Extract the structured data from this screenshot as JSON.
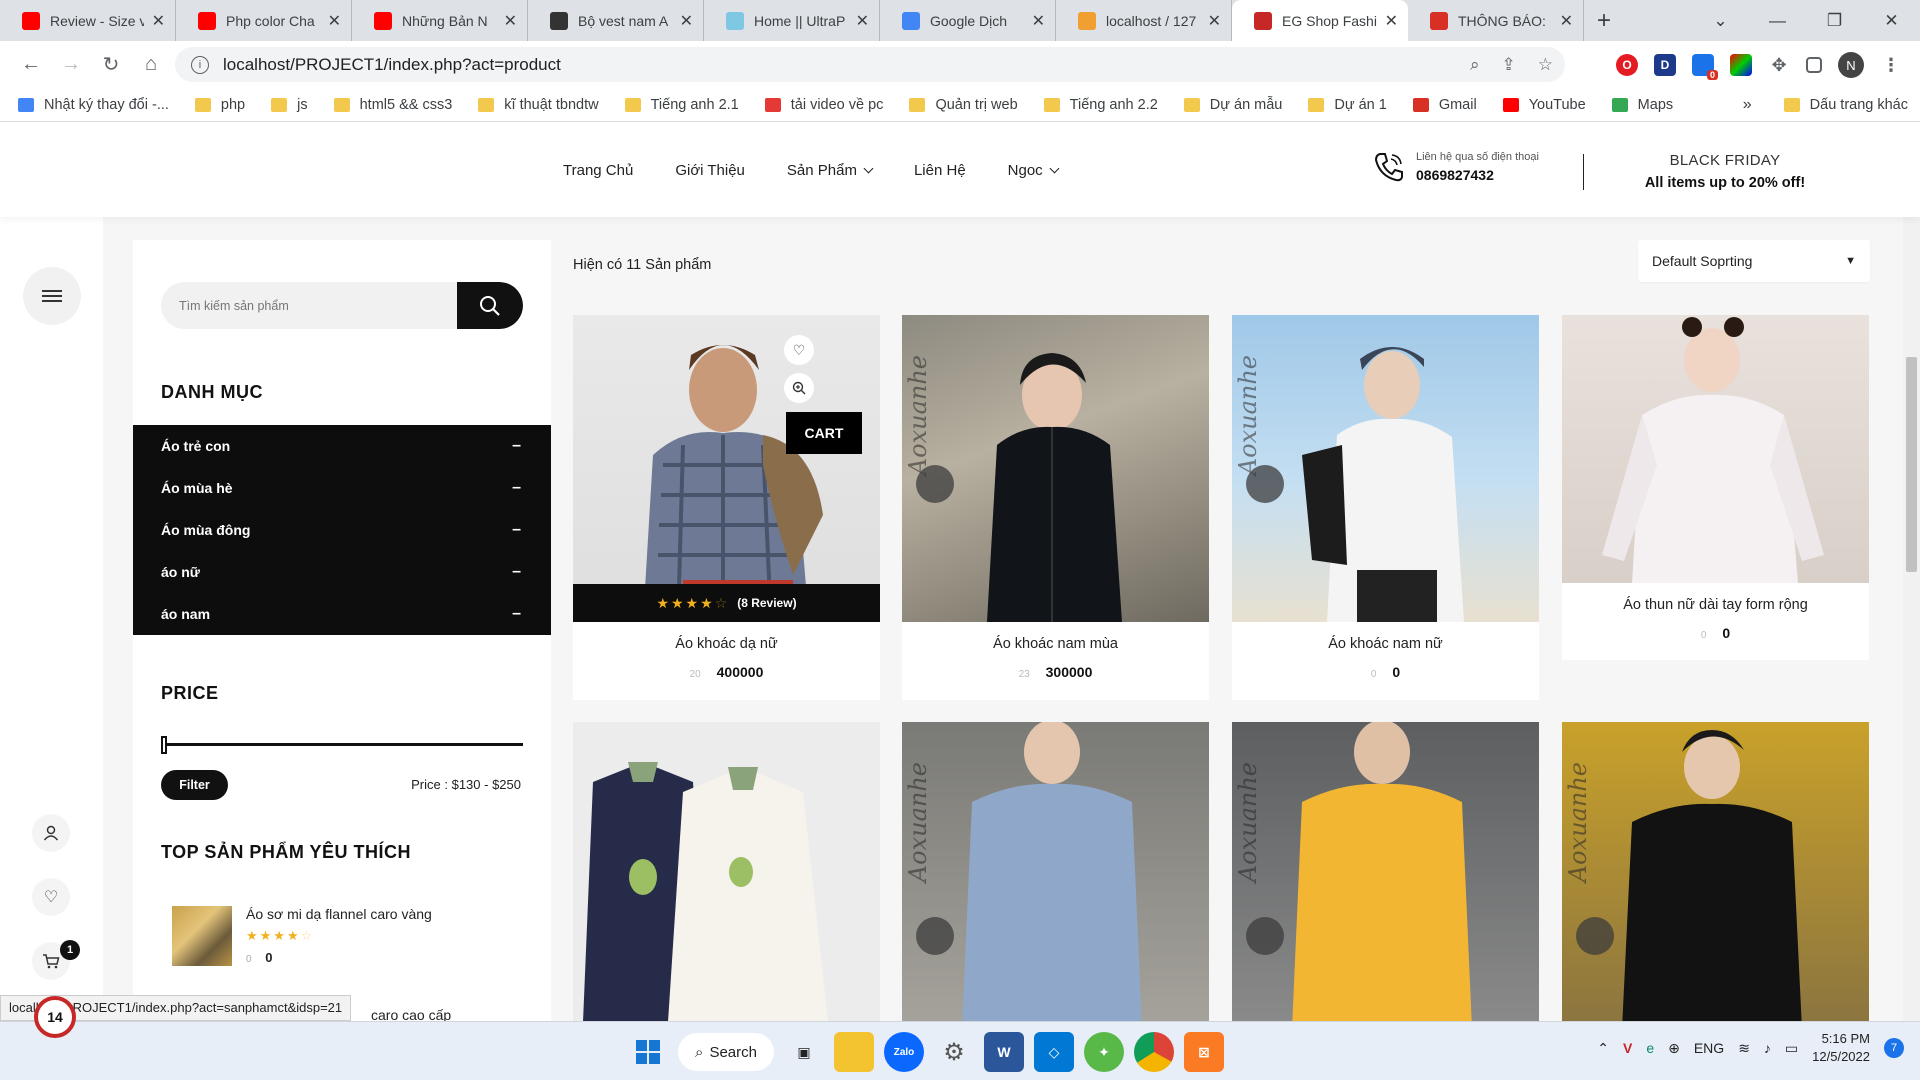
{
  "browser": {
    "tabs": [
      {
        "title": "Review - Size v",
        "icon": "youtube-icon",
        "color": "#ff0000"
      },
      {
        "title": "Php color Cha",
        "icon": "youtube-icon",
        "color": "#ff0000"
      },
      {
        "title": "Những Bản N",
        "icon": "youtube-icon",
        "color": "#ff0000"
      },
      {
        "title": "Bộ vest nam A",
        "icon": "store-icon",
        "color": "#333333"
      },
      {
        "title": "Home || UltraP",
        "icon": "ultraphone-icon",
        "color": "#7ec8e3"
      },
      {
        "title": "Google Dịch",
        "icon": "google-translate-icon",
        "color": "#4285f4"
      },
      {
        "title": "localhost / 127",
        "icon": "phpmyadmin-icon",
        "color": "#f0a030"
      },
      {
        "title": "EG Shop Fashi",
        "icon": "eg-shop-icon",
        "color": "#c62828",
        "active": true
      },
      {
        "title": "THÔNG BÁO:",
        "icon": "gmail-icon",
        "color": "#d93025"
      }
    ],
    "url": "localhost/PROJECT1/index.php?act=product",
    "profile_initial": "N",
    "ext_badge": "0",
    "bookmarks": [
      {
        "label": "Nhật ký thay đổi -...",
        "icon": "google-ads-icon"
      },
      {
        "label": "php",
        "icon": "folder-icon"
      },
      {
        "label": "js",
        "icon": "folder-icon"
      },
      {
        "label": "html5 && css3",
        "icon": "folder-icon"
      },
      {
        "label": "kĩ thuật tbndtw",
        "icon": "folder-icon"
      },
      {
        "label": "Tiếng anh 2.1",
        "icon": "folder-icon"
      },
      {
        "label": "tải video về pc",
        "icon": "4k-icon"
      },
      {
        "label": "Quản trị web",
        "icon": "folder-icon"
      },
      {
        "label": "Tiếng anh 2.2",
        "icon": "folder-icon"
      },
      {
        "label": "Dự án mẫu",
        "icon": "folder-icon"
      },
      {
        "label": "Dự án 1",
        "icon": "folder-icon"
      },
      {
        "label": "Gmail",
        "icon": "gmail-icon"
      },
      {
        "label": "YouTube",
        "icon": "youtube-icon"
      },
      {
        "label": "Maps",
        "icon": "maps-icon"
      }
    ],
    "bookmarks_more": "»",
    "other_bookmarks": "Dấu trang khác",
    "status_url": "localhost/PROJECT1/index.php?act=sanphamct&idsp=21"
  },
  "header": {
    "nav": [
      {
        "label": "Trang Chủ",
        "dropdown": false
      },
      {
        "label": "Giới Thiệu",
        "dropdown": false
      },
      {
        "label": "Sản Phẩm",
        "dropdown": true
      },
      {
        "label": "Liên Hệ",
        "dropdown": false
      },
      {
        "label": "Ngoc",
        "dropdown": true
      }
    ],
    "hotline_label": "Liên hệ qua số điện thoại",
    "hotline_number": "0869827432",
    "promo_title": "BLACK FRIDAY",
    "promo_text": "All items up to 20% off!"
  },
  "sidebar": {
    "search_placeholder": "Tìm kiếm sản phẩm",
    "category_title": "DANH MỤC",
    "categories": [
      "Áo trẻ con",
      "Áo mùa hè",
      "Áo mùa đông",
      "áo nữ",
      "áo nam"
    ],
    "category_toggle": "–",
    "price_title": "PRICE",
    "filter_label": "Filter",
    "price_range": "Price : $130 - $250",
    "top_title": "TOP SẢN PHẨM YÊU THÍCH",
    "top_items": [
      {
        "name": "Áo sơ mi dạ flannel caro vàng",
        "old_price": "0",
        "price": "0",
        "rating": 4
      },
      {
        "name": "caro cao cấp"
      }
    ]
  },
  "listing": {
    "result_count": "Hiện có 11 Sản phẩm",
    "sort_label": "Default Soprting",
    "cart_label": "CART",
    "review_text": "(8 Review)",
    "products": [
      {
        "name": "Áo khoác dạ nữ",
        "old_price": "20",
        "price": "400000",
        "rating": 4
      },
      {
        "name": "Áo khoác nam mùa",
        "old_price": "23",
        "price": "300000"
      },
      {
        "name": "Áo khoác nam nữ",
        "old_price": "0",
        "price": "0"
      },
      {
        "name": "Áo thun nữ dài tay form rộng",
        "old_price": "0",
        "price": "0"
      },
      {
        "name": ""
      },
      {
        "name": ""
      },
      {
        "name": ""
      },
      {
        "name": ""
      }
    ],
    "brand_watermark": "Aoxuanhe"
  },
  "rail": {
    "cart_count": "1"
  },
  "taskbar": {
    "search_label": "Search",
    "lang": "ENG",
    "time": "5:16 PM",
    "date": "12/5/2022",
    "notifications": "7",
    "floating_badge": "14"
  }
}
